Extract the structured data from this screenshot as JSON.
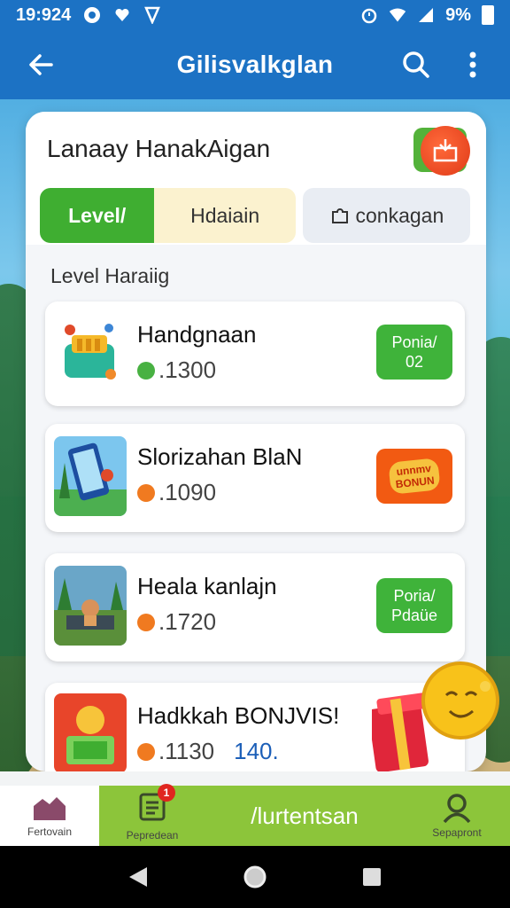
{
  "status_bar": {
    "time": "19:924",
    "battery": "9%"
  },
  "app_bar": {
    "title": "Gilisvalkglan"
  },
  "panel": {
    "title": "Lanaay HanakAigan",
    "tabs": [
      {
        "label": "Level/"
      },
      {
        "label": "Hdaiain"
      },
      {
        "label": "conkagan"
      }
    ],
    "section_label": "Level Haraiig",
    "cards": [
      {
        "title": "Handgnaan",
        "points": ".1300",
        "button_line1": "Ponia/",
        "button_line2": "02"
      },
      {
        "title": "Slorizahan BlaN",
        "points": ".1090",
        "button_line1": "unnmv",
        "button_line2": "BONUN"
      },
      {
        "title": "Heala kanlajn",
        "points": ".1720",
        "button_line1": "Poria/",
        "button_line2": "Pdaüe"
      },
      {
        "title": "Hadkkah BONJVIS!",
        "points": ".1130",
        "extra": "140."
      }
    ]
  },
  "bottom_nav": {
    "home_label": "Fertovain",
    "tasks_label": "Pepredean",
    "tasks_badge": "1",
    "center_label": "/lurtentsan",
    "profile_label": "Sepapront"
  },
  "colors": {
    "primary_blue": "#1c72c4",
    "green": "#3fae31",
    "lime": "#8cc53a",
    "orange": "#f25a12"
  }
}
